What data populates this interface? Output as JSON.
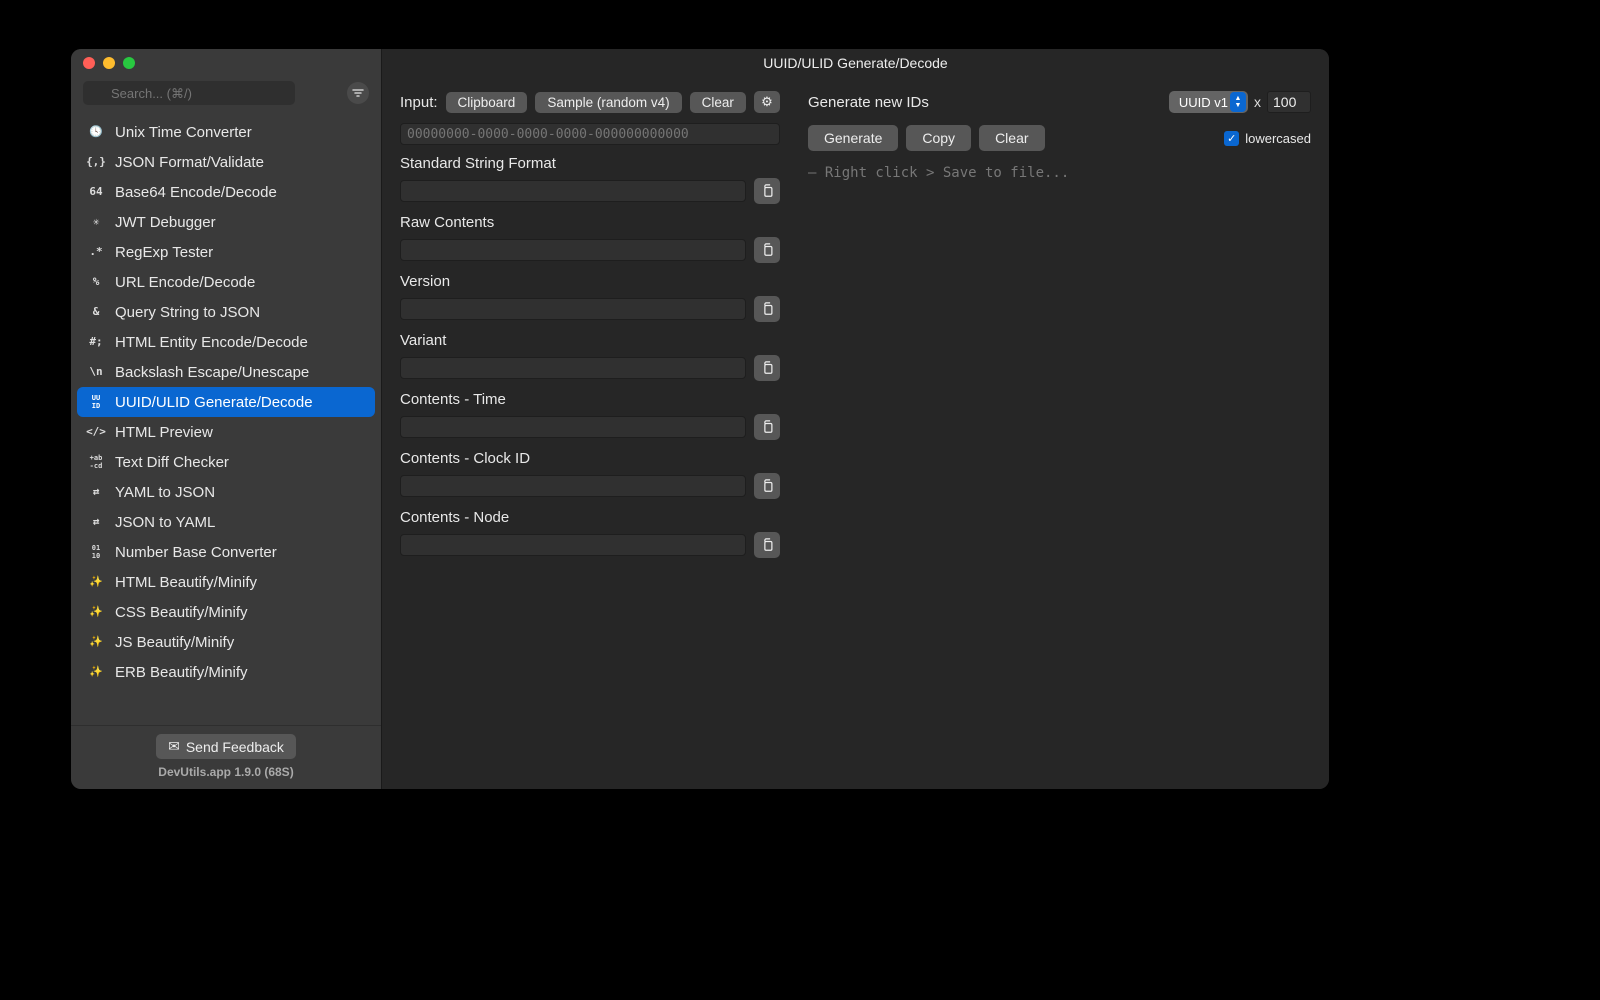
{
  "window_title": "UUID/ULID Generate/Decode",
  "search": {
    "placeholder": "Search... (⌘/)"
  },
  "sidebar": {
    "items": [
      {
        "icon": "🕓",
        "label": "Unix Time Converter"
      },
      {
        "icon": "{,}",
        "label": "JSON Format/Validate"
      },
      {
        "icon": "64",
        "label": "Base64 Encode/Decode"
      },
      {
        "icon": "✳︎",
        "label": "JWT Debugger"
      },
      {
        "icon": ".*",
        "label": "RegExp Tester"
      },
      {
        "icon": "%",
        "label": "URL Encode/Decode"
      },
      {
        "icon": "&",
        "label": "Query String to JSON"
      },
      {
        "icon": "#;",
        "label": "HTML Entity Encode/Decode"
      },
      {
        "icon": "\\n",
        "label": "Backslash Escape/Unescape"
      },
      {
        "icon": "UU\nID",
        "label": "UUID/ULID Generate/Decode",
        "selected": true
      },
      {
        "icon": "</>",
        "label": "HTML Preview"
      },
      {
        "icon": "+ab\n-cd",
        "label": "Text Diff Checker"
      },
      {
        "icon": "⇄",
        "label": "YAML to JSON"
      },
      {
        "icon": "⇄",
        "label": "JSON to YAML"
      },
      {
        "icon": "01\n10",
        "label": "Number Base Converter"
      },
      {
        "icon": "✨",
        "label": "HTML Beautify/Minify"
      },
      {
        "icon": "✨",
        "label": "CSS Beautify/Minify"
      },
      {
        "icon": "✨",
        "label": "JS Beautify/Minify"
      },
      {
        "icon": "✨",
        "label": "ERB Beautify/Minify"
      }
    ],
    "feedback_label": "Send Feedback",
    "version": "DevUtils.app 1.9.0 (68S)"
  },
  "decoder": {
    "input_label": "Input:",
    "btn_clipboard": "Clipboard",
    "btn_sample": "Sample (random v4)",
    "btn_clear": "Clear",
    "input_placeholder": "00000000-0000-0000-0000-000000000000",
    "fields": [
      {
        "label": "Standard String Format",
        "value": ""
      },
      {
        "label": "Raw Contents",
        "value": ""
      },
      {
        "label": "Version",
        "value": ""
      },
      {
        "label": "Variant",
        "value": ""
      },
      {
        "label": "Contents - Time",
        "value": ""
      },
      {
        "label": "Contents - Clock ID",
        "value": ""
      },
      {
        "label": "Contents - Node",
        "value": ""
      }
    ]
  },
  "generator": {
    "heading": "Generate new IDs",
    "type_selected": "UUID v1",
    "x_label": "x",
    "count": "100",
    "btn_generate": "Generate",
    "btn_copy": "Copy",
    "btn_clear": "Clear",
    "lowercase_label": "lowercased",
    "hint": "– Right click > Save to file..."
  }
}
